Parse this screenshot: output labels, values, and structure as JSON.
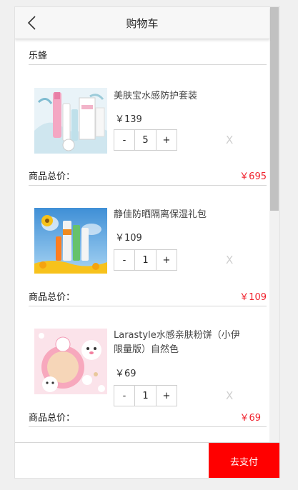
{
  "header": {
    "title": "购物车",
    "back_icon": "chevron-left-icon"
  },
  "shop": {
    "name": "乐蜂"
  },
  "items": [
    {
      "name": "美肤宝水感防护套装",
      "price": "￥139",
      "quantity": "5",
      "minus": "-",
      "plus": "+",
      "remove": "X",
      "total_label": "商品总价：",
      "total": "￥695"
    },
    {
      "name": "静佳防晒隔离保湿礼包",
      "price": "￥109",
      "quantity": "1",
      "minus": "-",
      "plus": "+",
      "remove": "X",
      "total_label": "商品总价：",
      "total": "￥109"
    },
    {
      "name": "Larastyle水感亲肤粉饼（小伊限量版）自然色",
      "price": "￥69",
      "quantity": "1",
      "minus": "-",
      "plus": "+",
      "remove": "X",
      "total_label": "商品总价：",
      "total": "￥69"
    }
  ],
  "footer": {
    "pay_label": "去支付"
  },
  "colors": {
    "accent": "#ff0000",
    "price_total": "#f0222d"
  }
}
